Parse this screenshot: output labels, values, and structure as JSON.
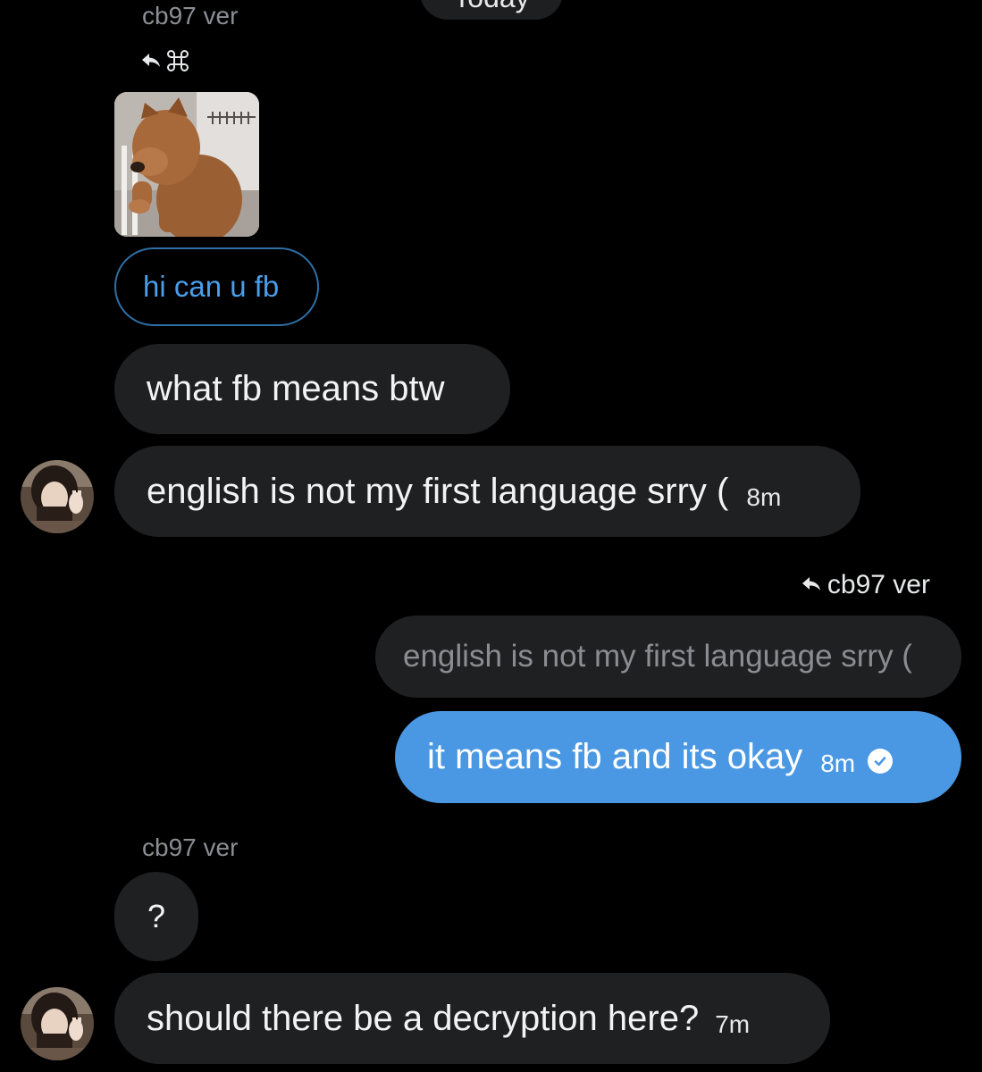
{
  "day_separator": "Today",
  "messages": {
    "reply_label_1": "cb97 ver",
    "story_reply_text": "hi can u fb",
    "msg_what_fb": "what fb means btw",
    "msg_english": "english is not my first language srry (",
    "msg_english_time": "8m",
    "quote_label": "cb97 ver",
    "quoted_text": "english is not my first language srry (",
    "my_reply": "it means fb and its okay",
    "my_reply_time": "8m",
    "reply_label_2": "cb97 ver",
    "msg_question": "?",
    "msg_decryption": "should there be a decryption here?",
    "msg_decryption_time": "7m"
  },
  "colors": {
    "background": "#000000",
    "incoming_bubble": "#1f2022",
    "outgoing_bubble": "#4a98e3",
    "story_reply_border": "#2f6fa5",
    "story_reply_text": "#4a9de6",
    "muted_text": "#8b8f94"
  },
  "icons": [
    "reply-arrow-icon",
    "command-key-icon",
    "read-check-icon"
  ]
}
